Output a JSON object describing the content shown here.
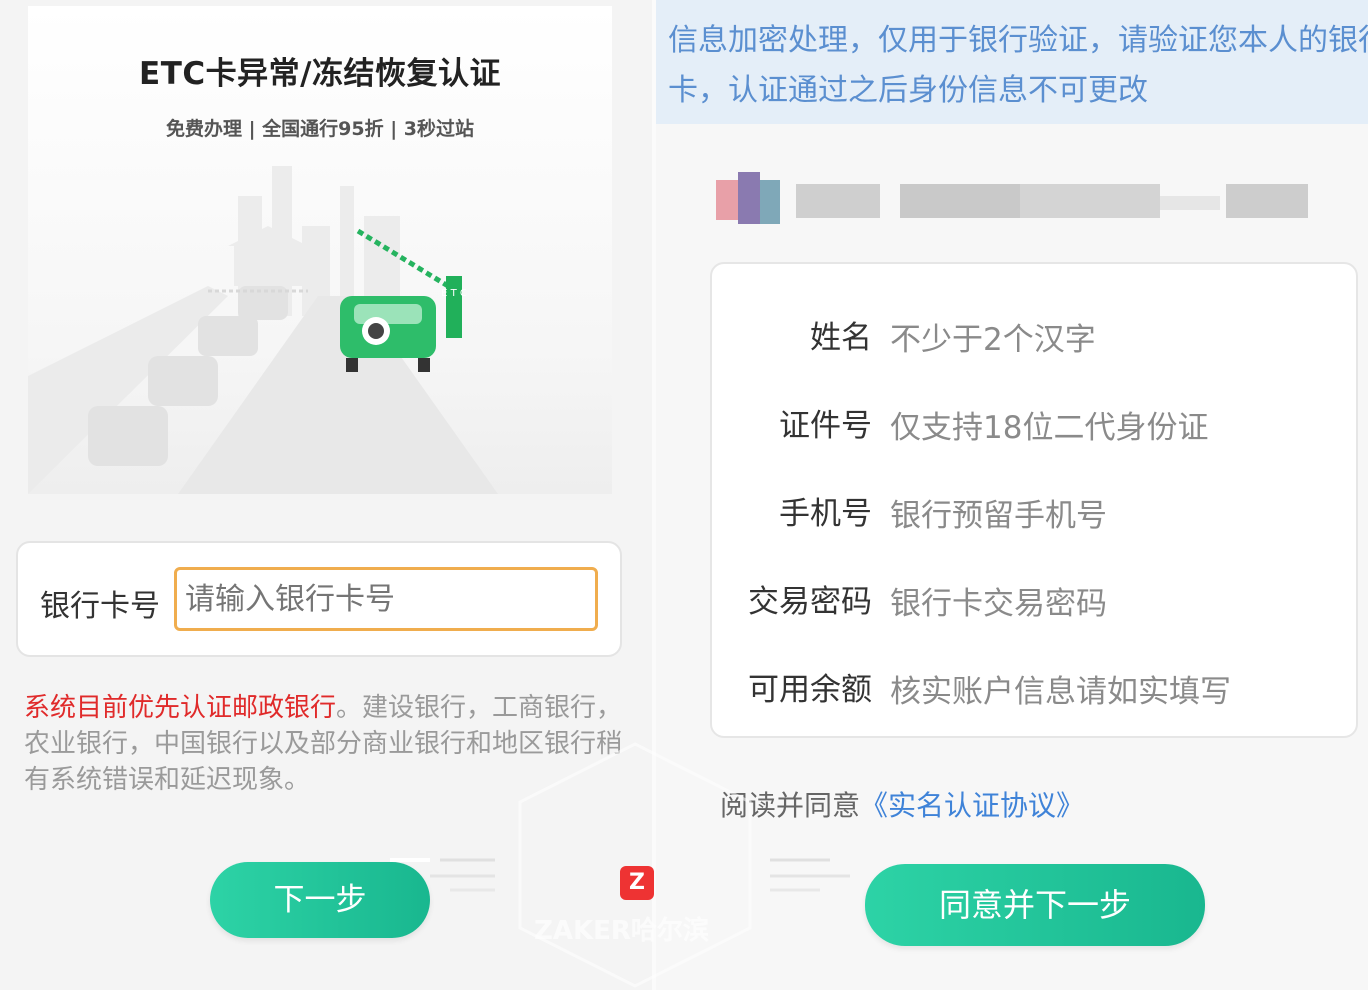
{
  "left": {
    "banner": {
      "title": "ETC卡异常/冻结恢复认证",
      "subtitle": "免费办理 | 全国通行95折 | 3秒过站",
      "gate_label": "E T C"
    },
    "card_input": {
      "label": "银行卡号",
      "placeholder": "请输入银行卡号"
    },
    "notice": {
      "highlight": "系统目前优先认证邮政银行",
      "rest": "。建设银行，工商银行，农业银行，中国银行以及部分商业银行和地区银行稍有系统错误和延迟现象。"
    },
    "next_button": "下一步"
  },
  "right": {
    "info_text": "信息加密处理，仅用于银行验证，请验证您本人的银行卡，认证通过之后身份信息不可更改",
    "form": [
      {
        "label": "姓名",
        "hint": "不少于2个汉字"
      },
      {
        "label": "证件号",
        "hint": "仅支持18位二代身份证"
      },
      {
        "label": "手机号",
        "hint": "银行预留手机号"
      },
      {
        "label": "交易密码",
        "hint": "银行卡交易密码"
      },
      {
        "label": "可用余额",
        "hint": "核实账户信息请如实填写"
      }
    ],
    "agree_text": "阅读并同意",
    "agree_link": "《实名认证协议》",
    "agree_button": "同意并下一步"
  },
  "watermark": {
    "logo": "Z",
    "text": "ZAKER哈尔滨"
  },
  "colors": {
    "accent": "#1fc39a",
    "warning": "#e02a2a",
    "link": "#3f83d8",
    "input_border": "#f0ad4e"
  }
}
